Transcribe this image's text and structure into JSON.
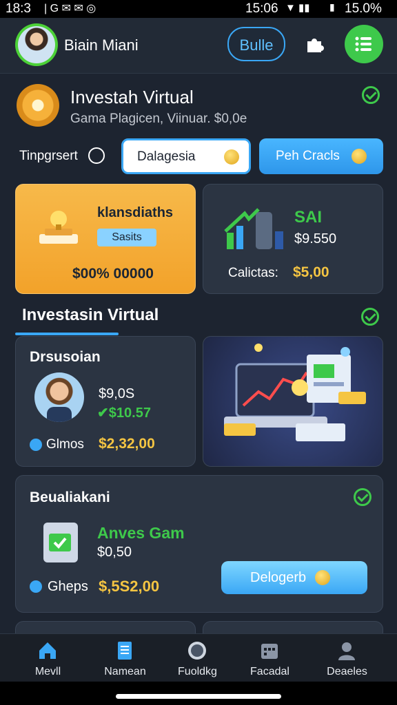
{
  "status_bar": {
    "time": "18:3",
    "clock": "15:06",
    "battery": "15.0%"
  },
  "header": {
    "user_name": "Biain Miani",
    "pill_label": "Bulle"
  },
  "hero": {
    "title": "Investah Virtual",
    "subtitle": "Gama Plagicen, Viinuar. $0,0e",
    "toggle_label": "Tinpgrsert",
    "btn_primary": "Dalagesia",
    "btn_secondary": "Peh Cracls"
  },
  "card_orange": {
    "title": "klansdiaths",
    "badge": "Sasits",
    "amount": "$00% 00000"
  },
  "card_sai": {
    "title": "SAI",
    "value": "$9.550",
    "caption_label": "Calictas:",
    "caption_value": "$5,00"
  },
  "section": {
    "title": "Investasin Virtual"
  },
  "card_person": {
    "title": "Drsusoian",
    "value1": "$9,0S",
    "value2": "$10.57",
    "footer_label": "Glmos",
    "footer_value": "$2,32,00"
  },
  "card_bottom": {
    "title": "Beualiakani",
    "product": "Anves Gam",
    "price": "$0,50",
    "footer_label": "Gheps",
    "footer_value": "$,5S2,00",
    "button": "Delogerb"
  },
  "nav": [
    {
      "label": "Mevll",
      "icon": "home-icon"
    },
    {
      "label": "Namean",
      "icon": "document-icon"
    },
    {
      "label": "Fuoldkg",
      "icon": "badge-icon"
    },
    {
      "label": "Facadal",
      "icon": "calendar-icon"
    },
    {
      "label": "Deaeles",
      "icon": "profile-icon"
    }
  ],
  "colors": {
    "accent_green": "#3ec94b",
    "accent_blue": "#3aa7f5",
    "gold": "#f5c542",
    "orange_card": "#f6b13a"
  }
}
